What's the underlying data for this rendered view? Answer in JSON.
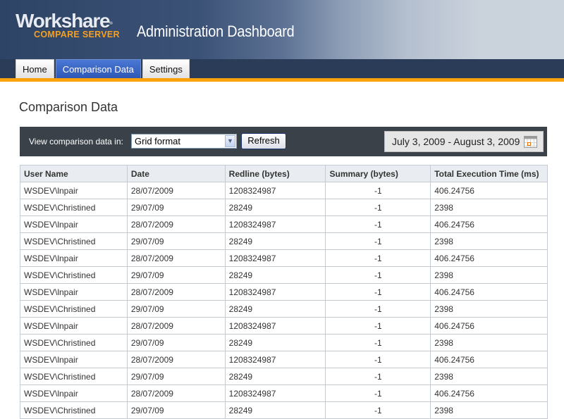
{
  "header": {
    "logo_main": "Workshare",
    "logo_sub": "COMPARE SERVER",
    "app_title": "Administration Dashboard"
  },
  "nav": {
    "tabs": [
      {
        "label": "Home",
        "active": false
      },
      {
        "label": "Comparison Data",
        "active": true
      },
      {
        "label": "Settings",
        "active": false
      }
    ]
  },
  "page": {
    "title": "Comparison Data"
  },
  "toolbar": {
    "view_label": "View comparison data in:",
    "format_selected": "Grid format",
    "refresh_label": "Refresh",
    "date_range": "July 3, 2009 - August 3, 2009",
    "calendar_icon": "calendar-icon"
  },
  "table": {
    "columns": [
      "User Name",
      "Date",
      "Redline (bytes)",
      "Summary (bytes)",
      "Total Execution Time (ms)"
    ],
    "rows": [
      [
        "WSDEV\\lnpair",
        "28/07/2009",
        "1208324987",
        "-1",
        "406.24756"
      ],
      [
        "WSDEV\\Christined",
        "29/07/09",
        "28249",
        "-1",
        "2398"
      ],
      [
        "WSDEV\\lnpair",
        "28/07/2009",
        "1208324987",
        "-1",
        "406.24756"
      ],
      [
        "WSDEV\\Christined",
        "29/07/09",
        "28249",
        "-1",
        "2398"
      ],
      [
        "WSDEV\\lnpair",
        "28/07/2009",
        "1208324987",
        "-1",
        "406.24756"
      ],
      [
        "WSDEV\\Christined",
        "29/07/09",
        "28249",
        "-1",
        "2398"
      ],
      [
        "WSDEV\\lnpair",
        "28/07/2009",
        "1208324987",
        "-1",
        "406.24756"
      ],
      [
        "WSDEV\\Christined",
        "29/07/09",
        "28249",
        "-1",
        "2398"
      ],
      [
        "WSDEV\\lnpair",
        "28/07/2009",
        "1208324987",
        "-1",
        "406.24756"
      ],
      [
        "WSDEV\\Christined",
        "29/07/09",
        "28249",
        "-1",
        "2398"
      ],
      [
        "WSDEV\\lnpair",
        "28/07/2009",
        "1208324987",
        "-1",
        "406.24756"
      ],
      [
        "WSDEV\\Christined",
        "29/07/09",
        "28249",
        "-1",
        "2398"
      ],
      [
        "WSDEV\\lnpair",
        "28/07/2009",
        "1208324987",
        "-1",
        "406.24756"
      ],
      [
        "WSDEV\\Christined",
        "29/07/09",
        "28249",
        "-1",
        "2398"
      ]
    ]
  },
  "colors": {
    "header_dark": "#2e4466",
    "nav_bar": "#2a3c58",
    "accent_orange": "#f8a10c",
    "active_tab": "#3a64c2",
    "toolbar_bg": "#3a4149"
  }
}
